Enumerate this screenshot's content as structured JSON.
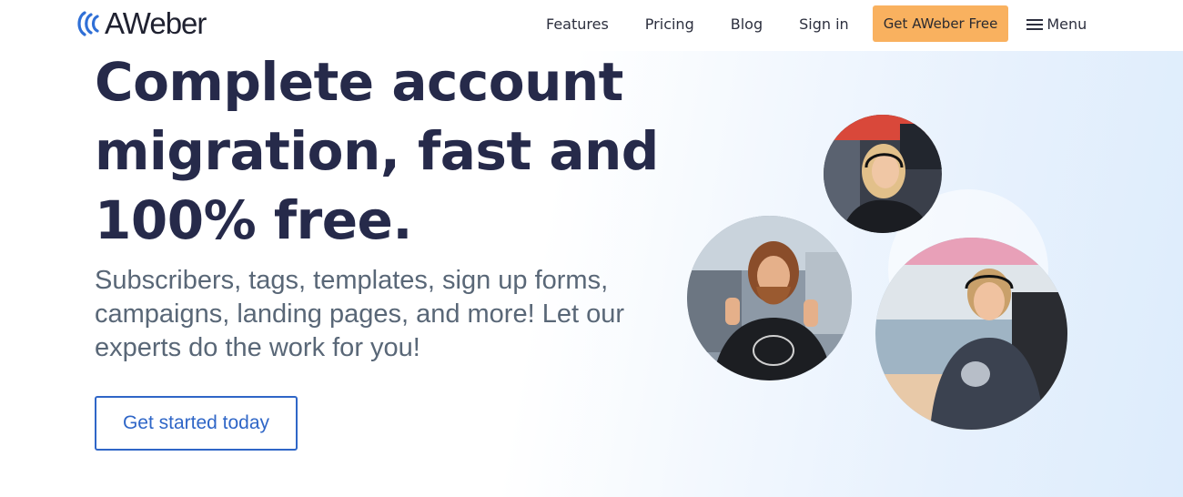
{
  "header": {
    "logo_text": "AWeber",
    "nav": {
      "features": "Features",
      "pricing": "Pricing",
      "blog": "Blog",
      "sign_in": "Sign in"
    },
    "cta_label": "Get AWeber Free",
    "menu_label": "Menu"
  },
  "hero": {
    "title": "Complete account migration, fast and 100% free.",
    "subtitle": "Subscribers, tags, templates, sign up forms, campaigns, landing pages, and more! Let our experts do the work for you!",
    "button_label": "Get started today"
  },
  "colors": {
    "brand_blue": "#2f66c7",
    "cta_orange": "#f9b15f",
    "heading_navy": "#262a4a"
  },
  "icons": {
    "logo": "aweber-wave-icon",
    "menu": "hamburger-icon"
  }
}
